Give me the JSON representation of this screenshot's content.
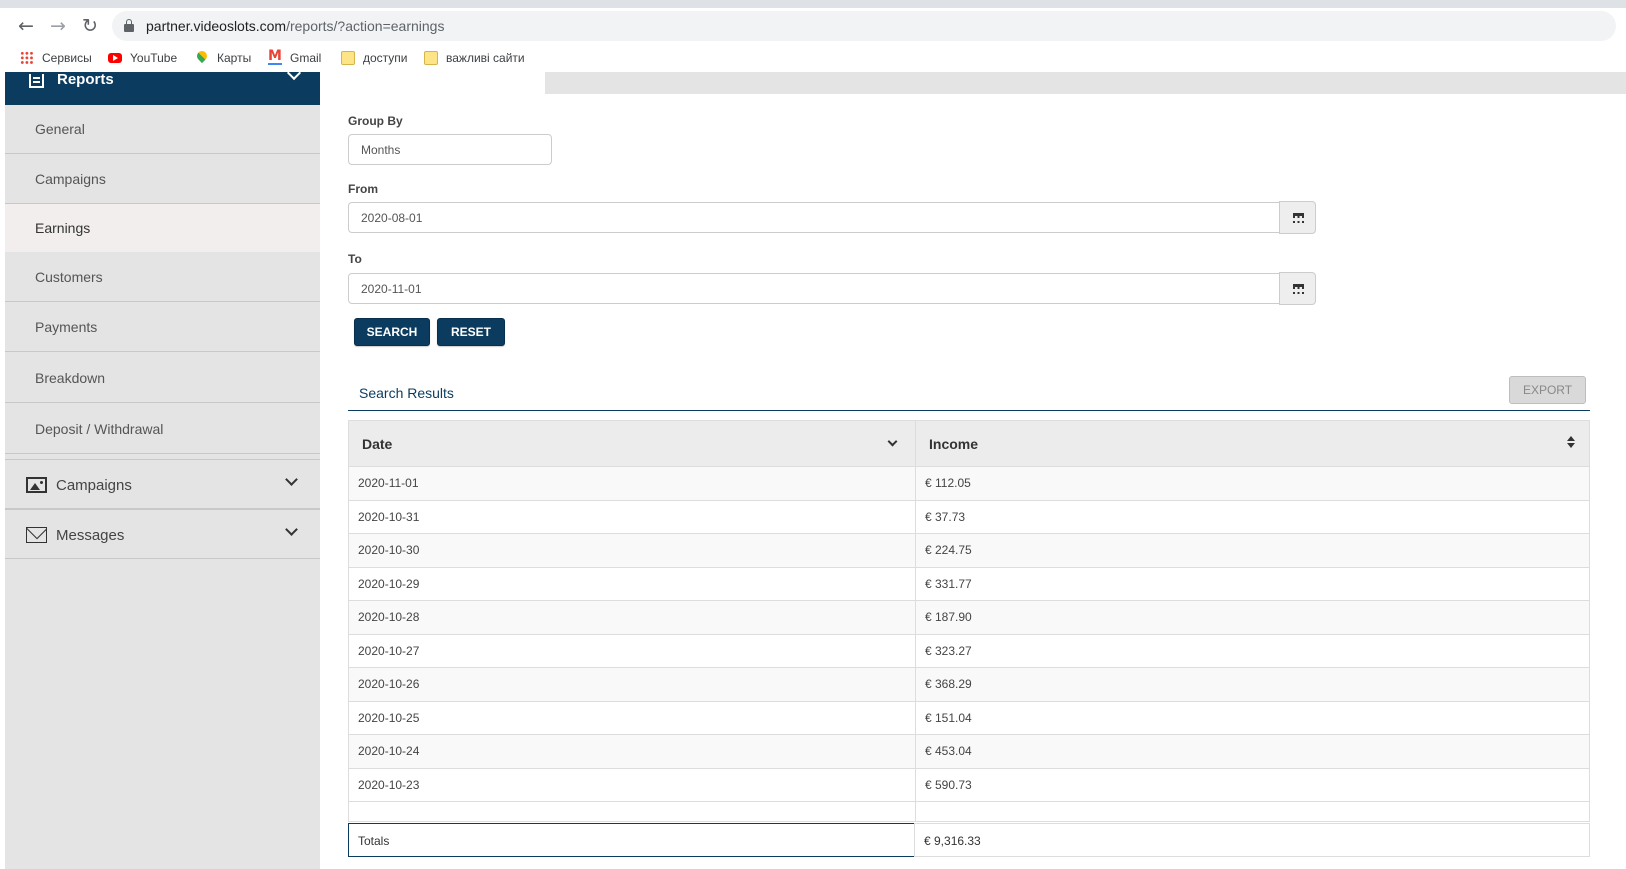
{
  "browser": {
    "url_host": "partner.videoslots.com",
    "url_path": "/reports/?action=earnings",
    "bookmarks": [
      {
        "label": "Сервисы",
        "icon": "apps-icon"
      },
      {
        "label": "YouTube",
        "icon": "youtube-icon"
      },
      {
        "label": "Карты",
        "icon": "maps-icon"
      },
      {
        "label": "Gmail",
        "icon": "gmail-icon"
      },
      {
        "label": "доступи",
        "icon": "folder-icon"
      },
      {
        "label": "важливі сайти",
        "icon": "folder-icon"
      }
    ]
  },
  "sidebar": {
    "section_title": "Reports",
    "items": [
      {
        "label": "General"
      },
      {
        "label": "Campaigns"
      },
      {
        "label": "Earnings",
        "active": true
      },
      {
        "label": "Customers"
      },
      {
        "label": "Payments"
      },
      {
        "label": "Breakdown"
      },
      {
        "label": "Deposit / Withdrawal"
      }
    ],
    "groups": [
      {
        "label": "Campaigns",
        "icon": "image-icon"
      },
      {
        "label": "Messages",
        "icon": "envelope-icon"
      }
    ]
  },
  "filters": {
    "group_by_label": "Group By",
    "group_by_value": "Months",
    "from_label": "From",
    "from_value": "2020-08-01",
    "to_label": "To",
    "to_value": "2020-11-01",
    "search_label": "SEARCH",
    "reset_label": "RESET"
  },
  "results": {
    "title": "Search Results",
    "export_label": "EXPORT",
    "columns": [
      "Date",
      "Income"
    ],
    "rows": [
      {
        "date": "2020-11-01",
        "income": "€ 112.05"
      },
      {
        "date": "2020-10-31",
        "income": "€ 37.73"
      },
      {
        "date": "2020-10-30",
        "income": "€ 224.75"
      },
      {
        "date": "2020-10-29",
        "income": "€ 331.77"
      },
      {
        "date": "2020-10-28",
        "income": "€ 187.90"
      },
      {
        "date": "2020-10-27",
        "income": "€ 323.27"
      },
      {
        "date": "2020-10-26",
        "income": "€ 368.29"
      },
      {
        "date": "2020-10-25",
        "income": "€ 151.04"
      },
      {
        "date": "2020-10-24",
        "income": "€ 453.04"
      },
      {
        "date": "2020-10-23",
        "income": "€ 590.73"
      }
    ],
    "totals_label": "Totals",
    "totals_value": "€ 9,316.33"
  },
  "colors": {
    "brand_navy": "#0b3c5f",
    "sidebar_bg": "#e4e4e4",
    "active_item_bg": "#f3eeee"
  }
}
